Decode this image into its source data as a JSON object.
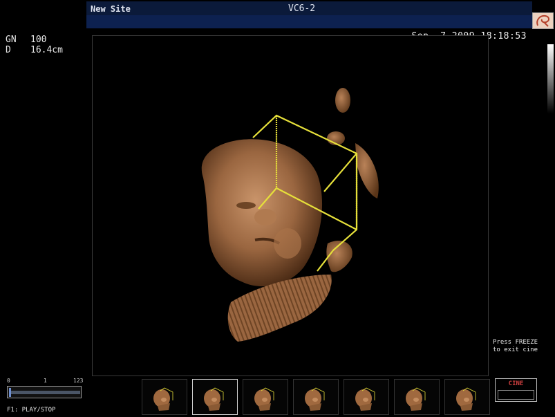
{
  "header": {
    "site": "New Site",
    "probe": "VC6-2",
    "datetime": "Sep- 7-2009 18:18:53"
  },
  "params": [
    {
      "key": "GN",
      "value": "100"
    },
    {
      "key": "D",
      "value": "16.4cm"
    }
  ],
  "overlay": {
    "freeze_line1": "Press FREEZE",
    "freeze_line2": "to exit cine"
  },
  "cine": {
    "scale_start": "0",
    "scale_mid": "1",
    "scale_end": "123",
    "position": 0.0,
    "button_label": "CINE"
  },
  "hint": "F1: PLAY/STOP",
  "thumbnails": {
    "count": 7,
    "selected_index": 1
  },
  "colors": {
    "header_bg": "#0b1a3a",
    "render_box": "#e6e03a",
    "tissue": "#a8724a",
    "cine_label": "#d04040"
  }
}
